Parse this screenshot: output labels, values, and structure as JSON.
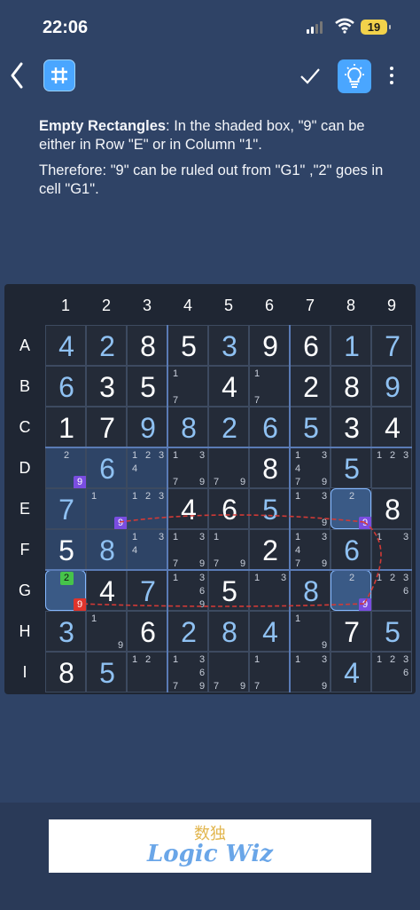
{
  "status": {
    "time": "22:06",
    "battery": "19"
  },
  "hint": {
    "line1_bold": "Empty Rectangles",
    "line1_rest": ": In the shaded box, \"9\" can be either in Row \"E\" or in Column \"1\".",
    "line2": "Therefore: \"9\" can be ruled out from \"G1\" ,\"2\" goes in cell \"G1\"."
  },
  "columns": [
    "1",
    "2",
    "3",
    "4",
    "5",
    "6",
    "7",
    "8",
    "9"
  ],
  "rows": [
    "A",
    "B",
    "C",
    "D",
    "E",
    "F",
    "G",
    "H",
    "I"
  ],
  "colors": {
    "background": "#2f4366",
    "accent": "#4aa6ff",
    "given": "#ffffff",
    "solved": "#8fc1f2",
    "purple": "#7a4de0",
    "red": "#e0342b",
    "green": "#46c44a"
  },
  "board": [
    [
      {
        "v": "4",
        "t": "s"
      },
      {
        "v": "2",
        "t": "s"
      },
      {
        "v": "8",
        "t": "g"
      },
      {
        "v": "5",
        "t": "g"
      },
      {
        "v": "3",
        "t": "s"
      },
      {
        "v": "9",
        "t": "g"
      },
      {
        "v": "6",
        "t": "g"
      },
      {
        "v": "1",
        "t": "s"
      },
      {
        "v": "7",
        "t": "s"
      }
    ],
    [
      {
        "v": "6",
        "t": "s"
      },
      {
        "v": "3",
        "t": "g"
      },
      {
        "v": "5",
        "t": "g"
      },
      {
        "c": [
          "1",
          "7"
        ]
      },
      {
        "v": "4",
        "t": "g"
      },
      {
        "c": [
          "1",
          "7"
        ]
      },
      {
        "v": "2",
        "t": "g"
      },
      {
        "v": "8",
        "t": "g"
      },
      {
        "v": "9",
        "t": "s"
      }
    ],
    [
      {
        "v": "1",
        "t": "g"
      },
      {
        "v": "7",
        "t": "g"
      },
      {
        "v": "9",
        "t": "s"
      },
      {
        "v": "8",
        "t": "s"
      },
      {
        "v": "2",
        "t": "s"
      },
      {
        "v": "6",
        "t": "s"
      },
      {
        "v": "5",
        "t": "s"
      },
      {
        "v": "3",
        "t": "g"
      },
      {
        "v": "4",
        "t": "g"
      }
    ],
    [
      {
        "c": [
          "2",
          "9"
        ]
      },
      {
        "v": "6",
        "t": "s"
      },
      {
        "c": [
          "1",
          "2",
          "3",
          "4"
        ]
      },
      {
        "c": [
          "1",
          "3",
          "7",
          "9"
        ]
      },
      {
        "c": [
          "7",
          "9"
        ]
      },
      {
        "v": "8",
        "t": "g"
      },
      {
        "c": [
          "1",
          "3",
          "4",
          "7",
          "9"
        ]
      },
      {
        "v": "5",
        "t": "s"
      },
      {
        "c": [
          "1",
          "2",
          "3"
        ]
      }
    ],
    [
      {
        "v": "7",
        "t": "s"
      },
      {
        "c": [
          "1",
          "9"
        ]
      },
      {
        "c": [
          "1",
          "2",
          "3"
        ]
      },
      {
        "v": "4",
        "t": "g"
      },
      {
        "v": "6",
        "t": "g"
      },
      {
        "v": "5",
        "t": "s"
      },
      {
        "c": [
          "1",
          "3",
          "9"
        ]
      },
      {
        "c": [
          "2",
          "9"
        ]
      },
      {
        "v": "8",
        "t": "g"
      }
    ],
    [
      {
        "v": "5",
        "t": "g"
      },
      {
        "v": "8",
        "t": "s"
      },
      {
        "c": [
          "1",
          "3",
          "4"
        ]
      },
      {
        "c": [
          "1",
          "3",
          "7",
          "9"
        ]
      },
      {
        "c": [
          "1",
          "7",
          "9"
        ]
      },
      {
        "v": "2",
        "t": "g"
      },
      {
        "c": [
          "1",
          "3",
          "4",
          "7",
          "9"
        ]
      },
      {
        "v": "6",
        "t": "s"
      },
      {
        "c": [
          "1",
          "3"
        ]
      }
    ],
    [
      {
        "c": [
          "2",
          "9"
        ]
      },
      {
        "v": "4",
        "t": "g"
      },
      {
        "v": "7",
        "t": "s"
      },
      {
        "c": [
          "1",
          "3",
          "6",
          "9"
        ]
      },
      {
        "v": "5",
        "t": "g"
      },
      {
        "c": [
          "1",
          "3"
        ]
      },
      {
        "v": "8",
        "t": "s"
      },
      {
        "c": [
          "2",
          "9"
        ]
      },
      {
        "c": [
          "1",
          "2",
          "3",
          "6"
        ]
      }
    ],
    [
      {
        "v": "3",
        "t": "s"
      },
      {
        "c": [
          "1",
          "9"
        ]
      },
      {
        "v": "6",
        "t": "g"
      },
      {
        "v": "2",
        "t": "s"
      },
      {
        "v": "8",
        "t": "s"
      },
      {
        "v": "4",
        "t": "s"
      },
      {
        "c": [
          "1",
          "9"
        ]
      },
      {
        "v": "7",
        "t": "g"
      },
      {
        "v": "5",
        "t": "s"
      }
    ],
    [
      {
        "v": "8",
        "t": "g"
      },
      {
        "v": "5",
        "t": "s"
      },
      {
        "c": [
          "1",
          "2"
        ]
      },
      {
        "c": [
          "1",
          "3",
          "6",
          "7",
          "9"
        ]
      },
      {
        "c": [
          "7",
          "9"
        ]
      },
      {
        "c": [
          "1",
          "7"
        ]
      },
      {
        "c": [
          "1",
          "3",
          "9"
        ]
      },
      {
        "v": "4",
        "t": "s"
      },
      {
        "c": [
          "1",
          "2",
          "3",
          "6"
        ]
      }
    ]
  ],
  "highlights": {
    "shaded_box": [
      [
        3,
        0
      ],
      [
        3,
        1
      ],
      [
        3,
        2
      ],
      [
        4,
        0
      ],
      [
        4,
        1
      ],
      [
        4,
        2
      ],
      [
        5,
        0
      ],
      [
        5,
        1
      ],
      [
        5,
        2
      ]
    ],
    "cell_highlight": [
      [
        4,
        7
      ],
      [
        6,
        0
      ],
      [
        6,
        7
      ]
    ],
    "marks": [
      {
        "r": 3,
        "c": 0,
        "d": "9",
        "k": "p"
      },
      {
        "r": 4,
        "c": 1,
        "d": "9",
        "k": "p"
      },
      {
        "r": 4,
        "c": 7,
        "d": "9",
        "k": "p"
      },
      {
        "r": 6,
        "c": 7,
        "d": "9",
        "k": "p"
      },
      {
        "r": 6,
        "c": 0,
        "d": "2",
        "k": "g"
      },
      {
        "r": 6,
        "c": 0,
        "d": "9",
        "k": "r"
      }
    ]
  },
  "ad": {
    "cn": "数独",
    "en": "Logic Wiz"
  }
}
